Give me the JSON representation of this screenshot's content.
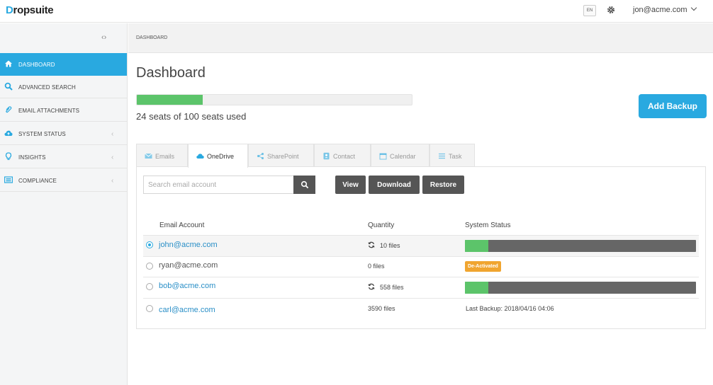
{
  "app": {
    "logo_lead": "D",
    "logo_rest": "ropsuite"
  },
  "topbar": {
    "lang": "EN",
    "user": "jon@acme.com"
  },
  "sidebar": {
    "items": [
      {
        "label": "DASHBOARD",
        "icon": "home-icon",
        "active": true
      },
      {
        "label": "ADVANCED SEARCH",
        "icon": "search-icon",
        "active": false
      },
      {
        "label": "EMAIL ATTACHMENTS",
        "icon": "paperclip-icon",
        "active": false
      },
      {
        "label": "SYSTEM STATUS",
        "icon": "cloud-icon",
        "active": false
      },
      {
        "label": "INSIGHTS",
        "icon": "lightbulb-icon",
        "active": false
      },
      {
        "label": "COMPLIANCE",
        "icon": "list-icon",
        "active": false
      }
    ]
  },
  "breadcrumb": "DASHBOARD",
  "main": {
    "title": "Dashboard",
    "seats_used": 24,
    "seats_total": 100,
    "seats_text": "24 seats of 100 seats used",
    "add_backup_label": "Add Backup"
  },
  "tabs": [
    {
      "label": "Emails",
      "icon": "mail-icon",
      "active": false
    },
    {
      "label": "OneDrive",
      "icon": "cloud-icon",
      "active": true
    },
    {
      "label": "SharePoint",
      "icon": "share-icon",
      "active": false
    },
    {
      "label": "Contact",
      "icon": "contact-icon",
      "active": false
    },
    {
      "label": "Calendar",
      "icon": "calendar-icon",
      "active": false
    },
    {
      "label": "Task",
      "icon": "task-list-icon",
      "active": false
    }
  ],
  "toolbar": {
    "search_placeholder": "Search email account",
    "view_label": "View",
    "download_label": "Download",
    "restore_label": "Restore"
  },
  "table": {
    "headers": {
      "account": "Email Account",
      "quantity": "Quantity",
      "status": "System Status"
    },
    "rows": [
      {
        "account": "john@acme.com",
        "quantity": "10 files",
        "syncing": true,
        "status_type": "progress",
        "progress": 0.1,
        "selected": true
      },
      {
        "account": "ryan@acme.com",
        "quantity": "0 files",
        "syncing": false,
        "status_type": "badge",
        "badge": "De-Activated",
        "selected": false
      },
      {
        "account": "bob@acme.com",
        "quantity": "558 files",
        "syncing": true,
        "status_type": "progress",
        "progress": 0.1,
        "selected": false
      },
      {
        "account": "carl@acme.com",
        "quantity": "3590 files",
        "syncing": false,
        "status_type": "text",
        "status_text": "Last Backup: 2018/04/16 04:06",
        "selected": false
      }
    ]
  },
  "colors": {
    "accent": "#29a9e0",
    "success": "#5cc46a",
    "warning": "#f0a530",
    "dark_button": "#555555"
  }
}
